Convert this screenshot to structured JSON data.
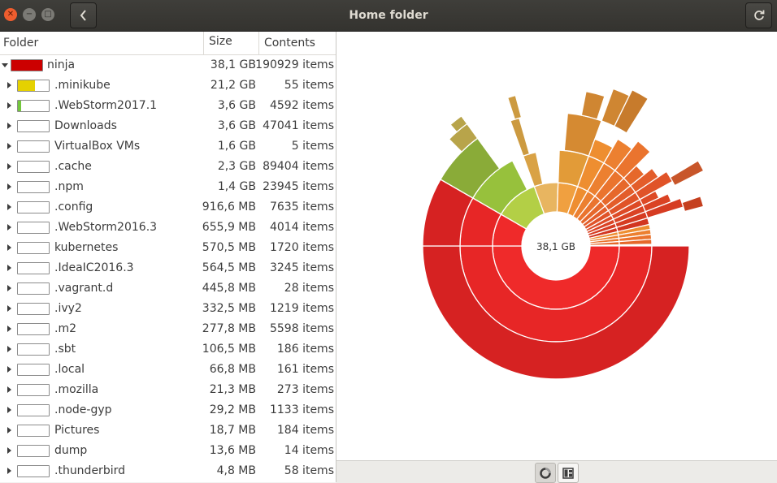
{
  "window": {
    "title": "Home folder",
    "back_icon": "chevron-left-icon",
    "refresh_icon": "refresh-icon"
  },
  "columns": {
    "folder": "Folder",
    "size": "Size",
    "contents": "Contents"
  },
  "root": {
    "name": "ninja",
    "size": "38,1 GB",
    "contents": "190929 items",
    "bar_fraction": 1.0,
    "bar_color": "#cc0000"
  },
  "folders": [
    {
      "name": ".minikube",
      "size": "21,2 GB",
      "contents": "55 items",
      "bar_fraction": 0.556,
      "bar_color": "#e5d100"
    },
    {
      "name": ".WebStorm2017.1",
      "size": "3,6 GB",
      "contents": "4592 items",
      "bar_fraction": 0.094,
      "bar_color": "#73c73c"
    },
    {
      "name": "Downloads",
      "size": "3,6 GB",
      "contents": "47041 items",
      "bar_fraction": 0.0,
      "bar_color": "#ffffff"
    },
    {
      "name": "VirtualBox VMs",
      "size": "1,6 GB",
      "contents": "5 items",
      "bar_fraction": 0.0,
      "bar_color": "#ffffff"
    },
    {
      "name": ".cache",
      "size": "2,3 GB",
      "contents": "89404 items",
      "bar_fraction": 0.0,
      "bar_color": "#ffffff"
    },
    {
      "name": ".npm",
      "size": "1,4 GB",
      "contents": "23945 items",
      "bar_fraction": 0.0,
      "bar_color": "#ffffff"
    },
    {
      "name": ".config",
      "size": "916,6 MB",
      "contents": "7635 items",
      "bar_fraction": 0.0,
      "bar_color": "#ffffff"
    },
    {
      "name": ".WebStorm2016.3",
      "size": "655,9 MB",
      "contents": "4014 items",
      "bar_fraction": 0.0,
      "bar_color": "#ffffff"
    },
    {
      "name": "kubernetes",
      "size": "570,5 MB",
      "contents": "1720 items",
      "bar_fraction": 0.0,
      "bar_color": "#ffffff"
    },
    {
      "name": ".IdeaIC2016.3",
      "size": "564,5 MB",
      "contents": "3245 items",
      "bar_fraction": 0.0,
      "bar_color": "#ffffff"
    },
    {
      "name": ".vagrant.d",
      "size": "445,8 MB",
      "contents": "28 items",
      "bar_fraction": 0.0,
      "bar_color": "#ffffff"
    },
    {
      "name": ".ivy2",
      "size": "332,5 MB",
      "contents": "1219 items",
      "bar_fraction": 0.0,
      "bar_color": "#ffffff"
    },
    {
      "name": ".m2",
      "size": "277,8 MB",
      "contents": "5598 items",
      "bar_fraction": 0.0,
      "bar_color": "#ffffff"
    },
    {
      "name": ".sbt",
      "size": "106,5 MB",
      "contents": "186 items",
      "bar_fraction": 0.0,
      "bar_color": "#ffffff"
    },
    {
      "name": ".local",
      "size": "66,8 MB",
      "contents": "161 items",
      "bar_fraction": 0.0,
      "bar_color": "#ffffff"
    },
    {
      "name": ".mozilla",
      "size": "21,3 MB",
      "contents": "273 items",
      "bar_fraction": 0.0,
      "bar_color": "#ffffff"
    },
    {
      "name": ".node-gyp",
      "size": "29,2 MB",
      "contents": "1133 items",
      "bar_fraction": 0.0,
      "bar_color": "#ffffff"
    },
    {
      "name": "Pictures",
      "size": "18,7 MB",
      "contents": "184 items",
      "bar_fraction": 0.0,
      "bar_color": "#ffffff"
    },
    {
      "name": "dump",
      "size": "13,6 MB",
      "contents": "14 items",
      "bar_fraction": 0.0,
      "bar_color": "#ffffff"
    },
    {
      "name": ".thunderbird",
      "size": "4,8 MB",
      "contents": "58 items",
      "bar_fraction": 0.0,
      "bar_color": "#ffffff"
    }
  ],
  "ring_chart": {
    "center_label": "38,1 GB"
  },
  "view_switch": {
    "ring_icon": "ring-chart-icon",
    "treemap_icon": "treemap-icon"
  }
}
